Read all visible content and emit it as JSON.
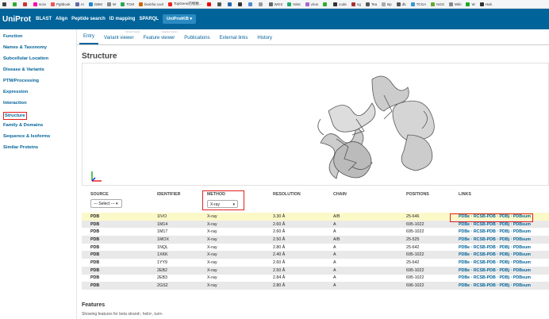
{
  "bookmarks": [
    {
      "label": "",
      "color": "#444"
    },
    {
      "label": "",
      "color": "#3a3"
    },
    {
      "label": "",
      "color": "#c33"
    },
    {
      "label": "scsv",
      "color": "#f0a"
    },
    {
      "label": "Pgitbook",
      "color": "#e55"
    },
    {
      "label": "AI",
      "color": "#66a"
    },
    {
      "label": "GBM",
      "color": "#28c"
    },
    {
      "label": "W",
      "color": "#888"
    },
    {
      "label": "TCM",
      "color": "#2a5"
    },
    {
      "label": "bioinfor.cool",
      "color": "#c60"
    },
    {
      "label": "TopGene药物数...",
      "color": "#e22"
    },
    {
      "label": "",
      "color": "#e00"
    },
    {
      "label": "",
      "color": "#555"
    },
    {
      "label": "",
      "color": "#26a"
    },
    {
      "label": "",
      "color": "#333"
    },
    {
      "label": "",
      "color": "#58c"
    },
    {
      "label": "",
      "color": "#999"
    },
    {
      "label": "WGS",
      "color": "#666"
    },
    {
      "label": "Nimt",
      "color": "#2a6"
    },
    {
      "label": "virus",
      "color": "#a6c"
    },
    {
      "label": "",
      "color": "#3a3"
    },
    {
      "label": "code",
      "color": "#333"
    },
    {
      "label": "ng",
      "color": "#a33"
    },
    {
      "label": "Tea",
      "color": "#555"
    },
    {
      "label": "Bp",
      "color": "#aaa"
    },
    {
      "label": "db",
      "color": "#555"
    },
    {
      "label": "TCGA",
      "color": "#39c"
    },
    {
      "label": "NGS",
      "color": "#6a3"
    },
    {
      "label": "Wiki",
      "color": "#888"
    },
    {
      "label": "W",
      "color": "#2a2"
    },
    {
      "label": "Hub",
      "color": "#333"
    }
  ],
  "top": {
    "logo": "UniProt",
    "nav": [
      "BLAST",
      "Align",
      "Peptide search",
      "ID mapping",
      "SPARQL"
    ],
    "kb": "UniProtKB ▾"
  },
  "sidebar": [
    "Function",
    "Names & Taxonomy",
    "Subcellular Location",
    "Disease & Variants",
    "PTM/Processing",
    "Expression",
    "Interaction",
    "Structure",
    "Family & Domains",
    "Sequence & Isoforms",
    "Similar Proteins"
  ],
  "tabs": [
    "Entry",
    "Variant viewer",
    "Feature viewer",
    "Publications",
    "External links",
    "History"
  ],
  "tiny": [
    "Variant viewer",
    "Feature viewer"
  ],
  "section_title": "Structure",
  "table": {
    "headers": [
      "SOURCE",
      "IDENTIFIER",
      "METHOD",
      "RESOLUTION",
      "CHAIN",
      "POSITIONS",
      "LINKS"
    ],
    "source_filter": "--- Select --- ▾",
    "method_filter": "X-ray",
    "rows": [
      [
        "PDB",
        "1IVO",
        "X-ray",
        "3.30 Å",
        "A/B",
        "25-646"
      ],
      [
        "PDB",
        "1M14",
        "X-ray",
        "2.60 Å",
        "A",
        "695-1022"
      ],
      [
        "PDB",
        "1M17",
        "X-ray",
        "2.60 Å",
        "A",
        "695-1022"
      ],
      [
        "PDB",
        "1MOX",
        "X-ray",
        "2.50 Å",
        "A/B",
        "25-525"
      ],
      [
        "PDB",
        "1NQL",
        "X-ray",
        "2.80 Å",
        "A",
        "25-642"
      ],
      [
        "PDB",
        "1XKK",
        "X-ray",
        "2.40 Å",
        "A",
        "695-1022"
      ],
      [
        "PDB",
        "1YY9",
        "X-ray",
        "2.60 Å",
        "A",
        "25-642"
      ],
      [
        "PDB",
        "2EB2",
        "X-ray",
        "2.50 Å",
        "A",
        "695-1022"
      ],
      [
        "PDB",
        "2EB3",
        "X-ray",
        "2.84 Å",
        "A",
        "695-1022"
      ],
      [
        "PDB",
        "2GS2",
        "X-ray",
        "2.80 Å",
        "A",
        "696-1022"
      ]
    ],
    "links": "PDBe · RCSB-PDB · PDBj · PDBsum"
  },
  "features": {
    "title": "Features",
    "subtitle": "Showing features for beta strand¹, helix¹, turn¹."
  }
}
